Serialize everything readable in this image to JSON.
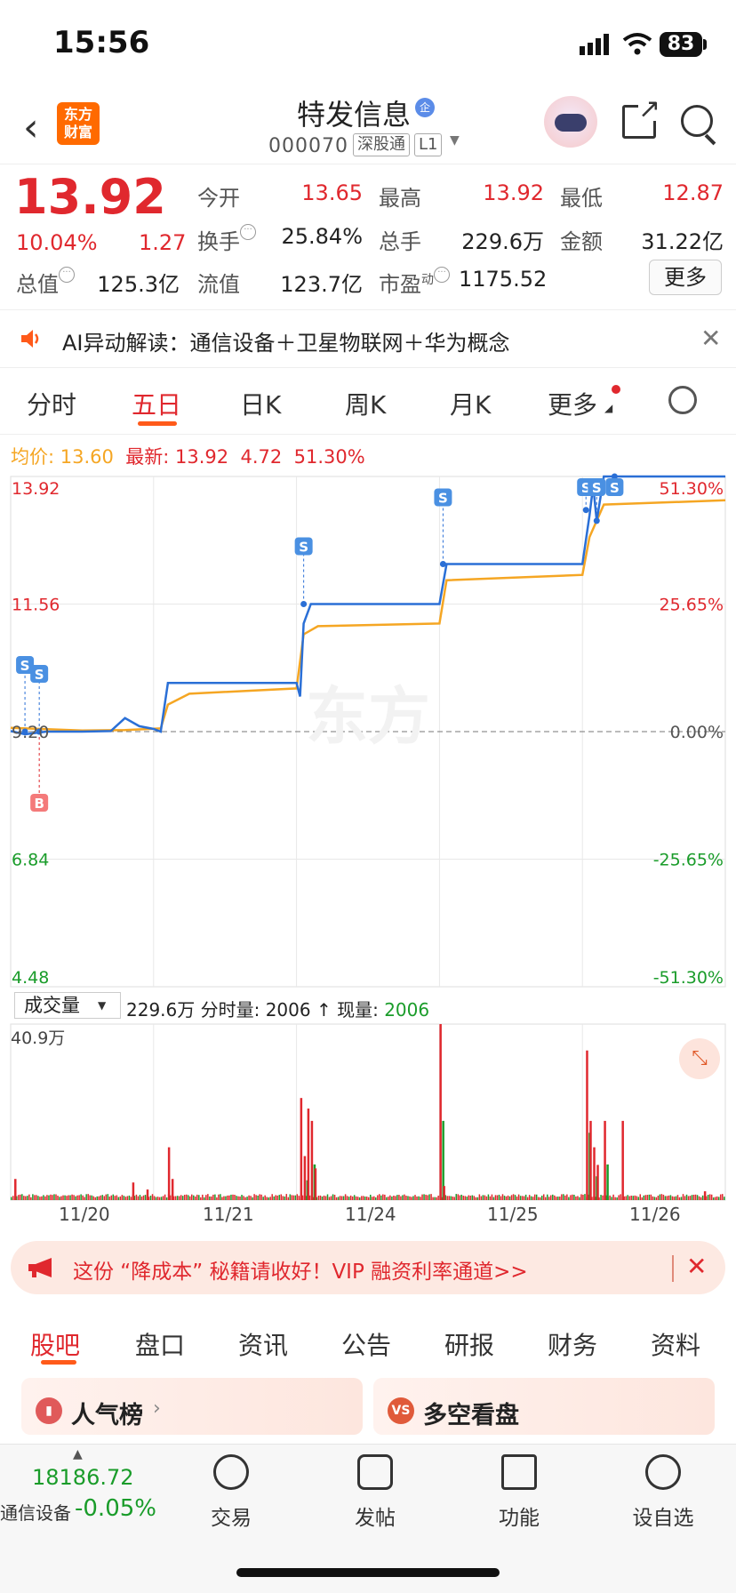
{
  "status_bar": {
    "time": "15:56",
    "battery": "83"
  },
  "header": {
    "stock_name": "特发信息",
    "badge": "企",
    "code": "000070",
    "tags": [
      "深股通",
      "L1"
    ],
    "logo_lines": [
      "东方",
      "财富"
    ]
  },
  "quote": {
    "price": "13.92",
    "change_pct": "10.04%",
    "change_abs": "1.27",
    "labels": {
      "open": "今开",
      "high": "最高",
      "low": "最低",
      "turnover": "换手",
      "volume": "总手",
      "amount": "金额",
      "total_cap": "总值",
      "float_cap": "流值",
      "pe": "市盈",
      "pe_sup": "动"
    },
    "values": {
      "open": "13.65",
      "high": "13.92",
      "low": "12.87",
      "turnover": "25.84%",
      "volume": "229.6万",
      "amount": "31.22亿",
      "total_cap": "125.3亿",
      "float_cap": "123.7亿",
      "pe": "1175.52"
    },
    "more": "更多"
  },
  "ai_bar": {
    "text": "AI异动解读：通信设备＋卫星物联网＋华为概念"
  },
  "tabs": [
    "分时",
    "五日",
    "日K",
    "周K",
    "月K",
    "更多"
  ],
  "legend": {
    "avg_label": "均价:",
    "avg_value": "13.60",
    "latest_label": "最新:",
    "latest_value": "13.92",
    "change": "4.72",
    "pct": "51.30%"
  },
  "chart_data": {
    "type": "line",
    "x_dates": [
      "11/20",
      "11/21",
      "11/24",
      "11/25",
      "11/26"
    ],
    "price_axis": {
      "left_ticks": [
        "13.92",
        "11.56",
        "9.20",
        "6.84",
        "4.48"
      ],
      "right_ticks": [
        "51.30%",
        "25.65%",
        "0.00%",
        "-25.65%",
        "-51.30%"
      ],
      "ylim": [
        4.48,
        13.92
      ]
    },
    "series": [
      {
        "name": "最新",
        "color": "#2a6fd6",
        "points": [
          [
            0,
            9.21
          ],
          [
            0.02,
            9.15
          ],
          [
            0.05,
            9.2
          ],
          [
            0.1,
            9.2
          ],
          [
            0.14,
            9.21
          ],
          [
            0.16,
            9.45
          ],
          [
            0.18,
            9.3
          ],
          [
            0.2,
            9.25
          ],
          [
            0.21,
            9.2
          ],
          [
            0.22,
            10.1
          ],
          [
            0.3,
            10.1
          ],
          [
            0.4,
            10.1
          ],
          [
            0.405,
            9.85
          ],
          [
            0.41,
            11.2
          ],
          [
            0.42,
            11.56
          ],
          [
            0.6,
            11.56
          ],
          [
            0.61,
            12.3
          ],
          [
            0.8,
            12.3
          ],
          [
            0.81,
            13.2
          ],
          [
            0.815,
            13.75
          ],
          [
            0.82,
            13.1
          ],
          [
            0.83,
            13.92
          ],
          [
            1.0,
            13.92
          ]
        ]
      },
      {
        "name": "均价",
        "color": "#f5a623",
        "points": [
          [
            0,
            9.27
          ],
          [
            0.1,
            9.22
          ],
          [
            0.16,
            9.23
          ],
          [
            0.21,
            9.26
          ],
          [
            0.22,
            9.7
          ],
          [
            0.25,
            9.9
          ],
          [
            0.4,
            10.0
          ],
          [
            0.41,
            11.0
          ],
          [
            0.43,
            11.15
          ],
          [
            0.6,
            11.2
          ],
          [
            0.61,
            12.0
          ],
          [
            0.8,
            12.1
          ],
          [
            0.81,
            12.8
          ],
          [
            0.83,
            13.4
          ],
          [
            1.0,
            13.48
          ]
        ]
      }
    ],
    "volume": {
      "max_label": "40.9万",
      "dropdown": "成交量",
      "stats": "229.6万 分时量: 2006 ↑ 现量: ",
      "current": "2006"
    },
    "markers": [
      {
        "t": 0.02,
        "label": "S",
        "price": 9.2
      },
      {
        "t": 0.04,
        "label": "S",
        "price": 9.2
      },
      {
        "t": 0.04,
        "label": "B",
        "price": 9.2
      },
      {
        "t": 0.41,
        "label": "S",
        "price": 11.56
      },
      {
        "t": 0.605,
        "label": "S",
        "price": 12.3
      },
      {
        "t": 0.805,
        "label": "S",
        "price": 13.3
      },
      {
        "t": 0.82,
        "label": "S",
        "price": 13.1
      },
      {
        "t": 0.845,
        "label": "S",
        "price": 13.92
      }
    ]
  },
  "promo": {
    "text": "这份 “降成本” 秘籍请收好！VIP 融资利率通道>>"
  },
  "bottom_tabs": [
    "股吧",
    "盘口",
    "资讯",
    "公告",
    "研报",
    "财务",
    "资料"
  ],
  "cards": [
    {
      "title": "人气榜",
      "icon": "bar-chart"
    },
    {
      "title": "多空看盘",
      "icon": "vs"
    }
  ],
  "bottom_nav": {
    "index_value": "18186.72",
    "index_name": "通信设备",
    "index_pct": "-0.05%",
    "items": [
      "交易",
      "发帖",
      "功能",
      "设自选"
    ]
  }
}
